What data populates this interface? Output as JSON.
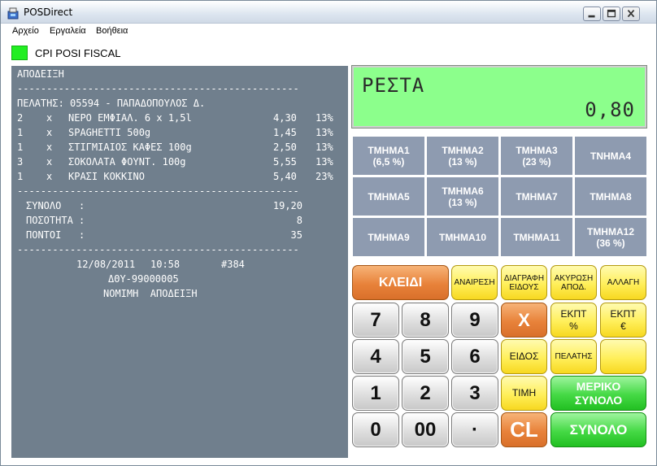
{
  "window": {
    "title": "POSDirect"
  },
  "menu": [
    "Αρχείο",
    "Εργαλεία",
    "Βοήθεια"
  ],
  "printer": {
    "label": "CPI POSI FISCAL",
    "status_color": "#22ee22"
  },
  "receipt": {
    "header": "ΑΠΟΔΕΙΞΗ",
    "separator": "------------------------------------------------",
    "customer": "ΠΕΛΑΤΗΣ: 05594 - ΠΑΠΑΔΟΠΟΥΛΟΣ Δ.",
    "items": [
      {
        "qty": "2",
        "x": "x",
        "name": "ΝΕΡΟ ΕΜΦΙΑΛ. 6 x 1,5l",
        "price": "4,30",
        "vat": "13%"
      },
      {
        "qty": "1",
        "x": "x",
        "name": "SPAGHETTI 500g",
        "price": "1,45",
        "vat": "13%"
      },
      {
        "qty": "1",
        "x": "x",
        "name": "ΣΤΙΓΜΙΑΙΟΣ ΚΑΦΕΣ 100g",
        "price": "2,50",
        "vat": "13%"
      },
      {
        "qty": "3",
        "x": "x",
        "name": "ΣΟΚΟΛΑΤΑ ΦΟΥΝΤ. 100g",
        "price": "5,55",
        "vat": "13%"
      },
      {
        "qty": "1",
        "x": "x",
        "name": "ΚΡΑΣΙ ΚΟΚΚΙΝΟ",
        "price": "5,40",
        "vat": "23%"
      }
    ],
    "totals": [
      {
        "label": "ΣΥΝΟΛΟ   :",
        "value": "19,20"
      },
      {
        "label": "ΠΟΣΟΤΗΤΑ :",
        "value": "8"
      },
      {
        "label": "ΠΟΝΤΟΙ   :",
        "value": "35"
      }
    ],
    "date": "12/08/2011",
    "time": "10:58",
    "number": "#384",
    "tax_id": "ΔΘΥ-99000005",
    "legal": "ΝΟΜΙΜΗ  ΑΠΟΔΕΙΞΗ"
  },
  "display": {
    "label": "ΡΕΣΤΑ",
    "value": "0,80",
    "bg_color": "#8cff8c"
  },
  "departments": [
    {
      "name": "ΤΜΗΜΑ1",
      "rate": "(6,5 %)"
    },
    {
      "name": "ΤΜΗΜΑ2",
      "rate": "(13 %)"
    },
    {
      "name": "ΤΜΗΜΑ3",
      "rate": "(23 %)"
    },
    {
      "name": "ΤΝΗΜΑ4",
      "rate": ""
    },
    {
      "name": "ΤΜΗΜΑ5",
      "rate": ""
    },
    {
      "name": "ΤΜΗΜΑ6",
      "rate": "(13 %)"
    },
    {
      "name": "ΤΜΗΜΑ7",
      "rate": ""
    },
    {
      "name": "ΤΜΗΜΑ8",
      "rate": ""
    },
    {
      "name": "ΤΜΗΜΑ9",
      "rate": ""
    },
    {
      "name": "ΤΜΗΜΑ10",
      "rate": ""
    },
    {
      "name": "ΤΜΗΜΑ11",
      "rate": ""
    },
    {
      "name": "ΤΜΗΜΑ12",
      "rate": "(36 %)"
    }
  ],
  "keys": {
    "key_button": "ΚΛΕΙΔΙ",
    "recall": "ΑΝΑΙΡΕΣΗ",
    "delete_item_1": "ΔΙΑΓΡΑΦΗ",
    "delete_item_2": "ΕΙΔΟΥΣ",
    "cancel_receipt_1": "ΑΚΥΡΩΣΗ",
    "cancel_receipt_2": "ΑΠΟΔ.",
    "change": "ΑΛΛΑΓΗ",
    "multiply": "X",
    "disc_pct_1": "ΕΚΠΤ",
    "disc_pct_2": "%",
    "disc_eur_1": "ΕΚΠΤ",
    "disc_eur_2": "€",
    "item": "ΕΙΔΟΣ",
    "customer": "ΠΕΛΑΤΗΣ",
    "price": "ΤΙΜΗ",
    "subtotal_1": "ΜΕΡΙΚΟ",
    "subtotal_2": "ΣΥΝΟΛΟ",
    "clear": "CL",
    "total": "ΣΥΝΟΛΟ",
    "digits": [
      "7",
      "8",
      "9",
      "4",
      "5",
      "6",
      "1",
      "2",
      "3",
      "0",
      "00",
      "·"
    ]
  }
}
